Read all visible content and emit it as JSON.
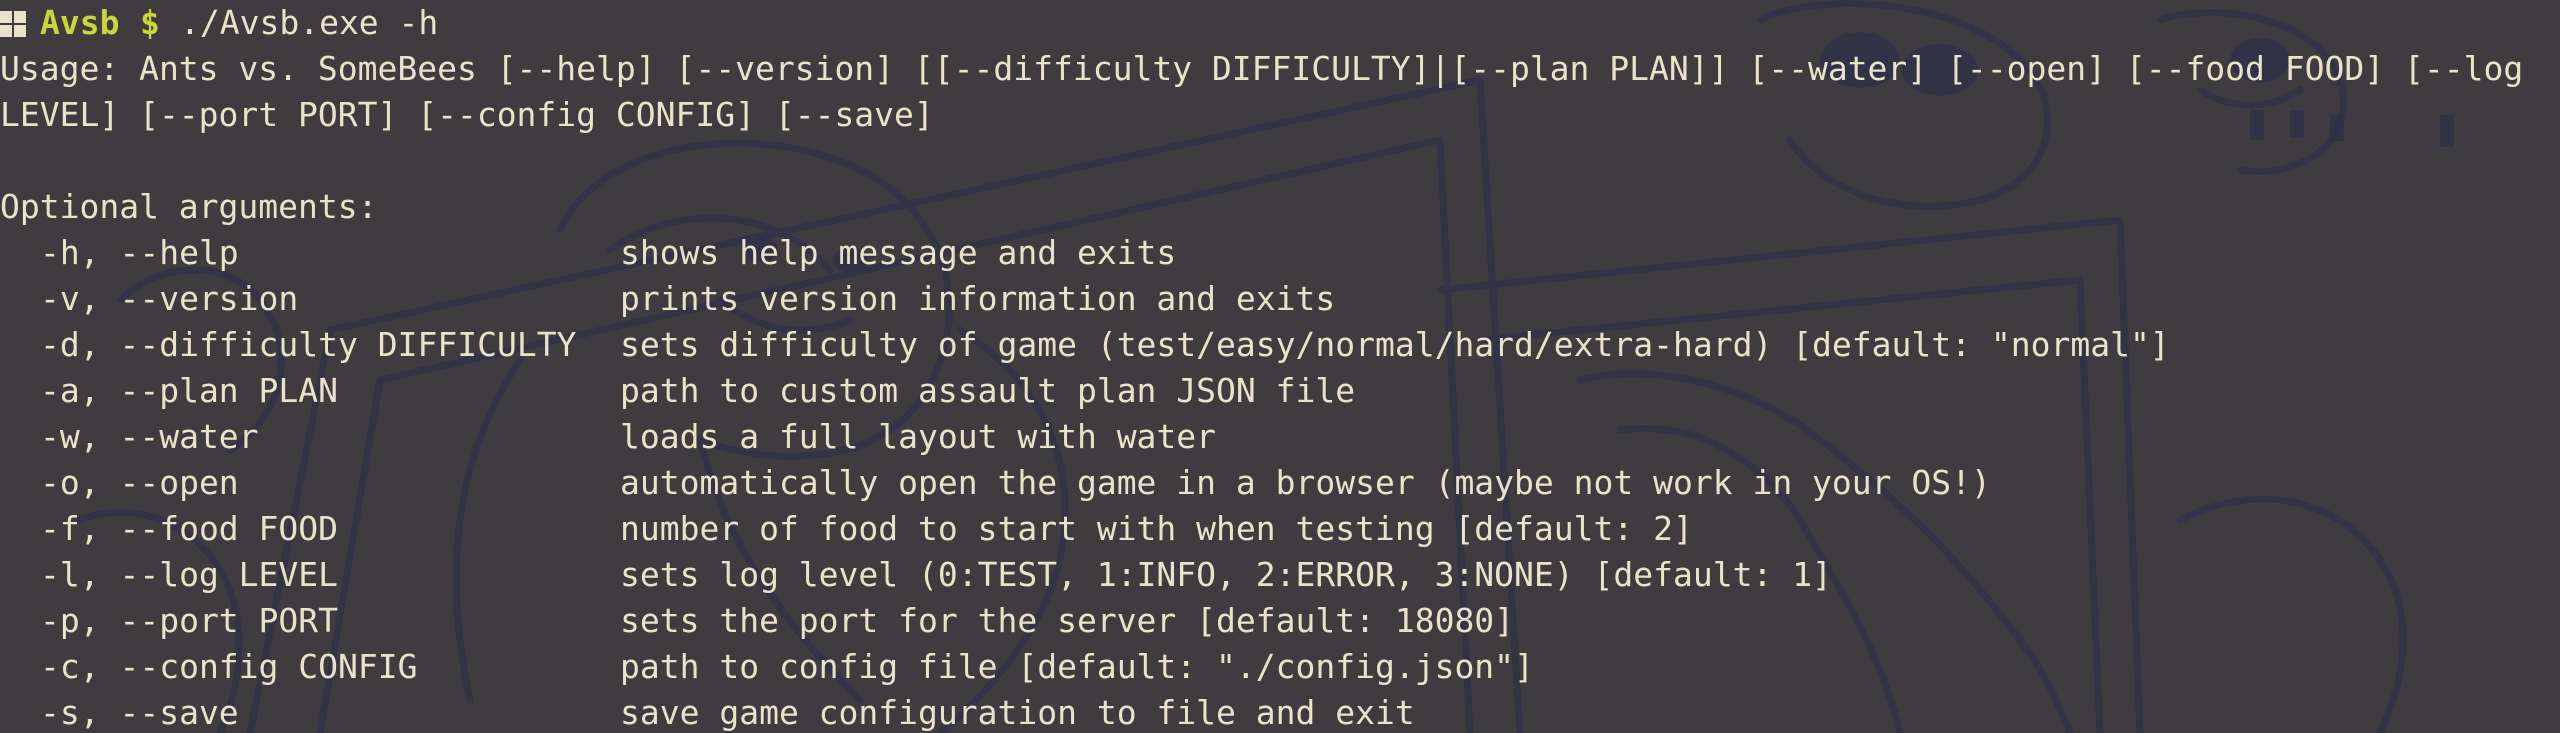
{
  "prompt": {
    "os_icon": "windows-icon",
    "user": "Avsb",
    "symbol": "$",
    "command": "./Avsb.exe -h"
  },
  "usage": {
    "line1": "Usage: Ants vs. SomeBees [--help] [--version] [[--difficulty DIFFICULTY]|[--plan PLAN]] [--water] [--open] [--food FOOD] [--log",
    "line2": "LEVEL] [--port PORT] [--config CONFIG] [--save]"
  },
  "optional_heading": "Optional arguments:",
  "options": [
    {
      "flag": "-h, --help",
      "desc": "shows help message and exits"
    },
    {
      "flag": "-v, --version",
      "desc": "prints version information and exits"
    },
    {
      "flag": "-d, --difficulty DIFFICULTY",
      "desc": "sets difficulty of game (test/easy/normal/hard/extra-hard) [default: \"normal\"]"
    },
    {
      "flag": "-a, --plan PLAN",
      "desc": "path to custom assault plan JSON file"
    },
    {
      "flag": "-w, --water",
      "desc": "loads a full layout with water"
    },
    {
      "flag": "-o, --open",
      "desc": "automatically open the game in a browser (maybe not work in your OS!)"
    },
    {
      "flag": "-f, --food FOOD",
      "desc": "number of food to start with when testing [default: 2]"
    },
    {
      "flag": "-l, --log LEVEL",
      "desc": "sets log level (0:TEST, 1:INFO, 2:ERROR, 3:NONE) [default: 1]"
    },
    {
      "flag": "-p, --port PORT",
      "desc": "sets the port for the server [default: 18080]"
    },
    {
      "flag": "-c, --config CONFIG",
      "desc": "path to config file [default: \"./config.json\"]"
    },
    {
      "flag": "-s, --save",
      "desc": "save game configuration to file and exit"
    }
  ],
  "colors": {
    "background": "#3f3c40",
    "foreground": "#e9e3cb",
    "prompt_accent": "#c9d63a",
    "art_ink": "#2e2f4c"
  }
}
